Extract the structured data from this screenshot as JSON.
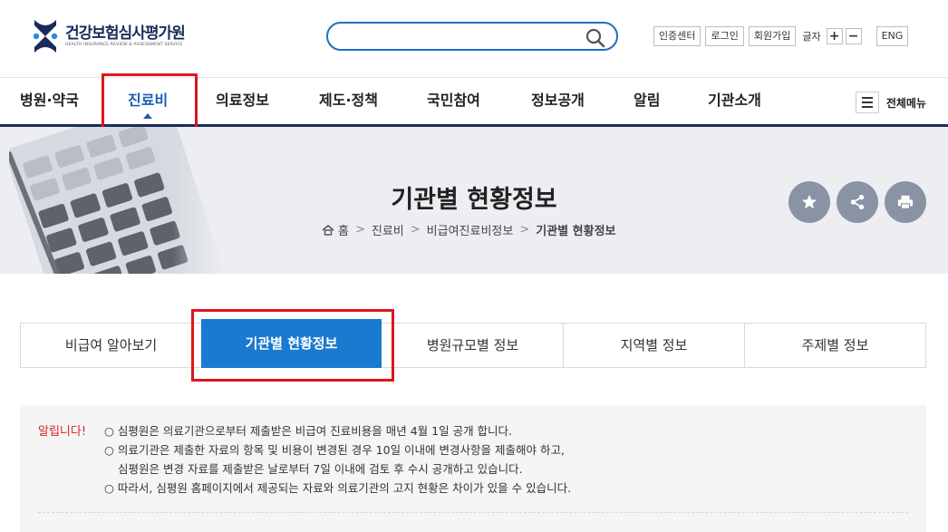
{
  "header": {
    "logo_name": "건강보험심사평가원",
    "logo_sub": "HEALTH INSURANCE REVIEW & ASSESSMENT SERVICE",
    "search": {
      "value": "",
      "placeholder": ""
    },
    "util": {
      "cert": "인증센터",
      "login": "로그인",
      "join": "회원가입",
      "font_label": "글자",
      "font_plus": "+",
      "font_minus": "−",
      "lang": "ENG"
    }
  },
  "gnb": {
    "items": [
      "병원·약국",
      "진료비",
      "의료정보",
      "제도·정책",
      "국민참여",
      "정보공개",
      "알림",
      "기관소개"
    ],
    "active_index": 1,
    "all_menu": "전체메뉴"
  },
  "banner": {
    "title": "기관별 현황정보",
    "breadcrumb": [
      "홈",
      "진료비",
      "비급여진료비정보",
      "기관별 현황정보"
    ],
    "actions": [
      "star-icon",
      "share-icon",
      "print-icon"
    ]
  },
  "tabs": {
    "items": [
      "비급여 알아보기",
      "기관별 현황정보",
      "병원규모별 정보",
      "지역별 정보",
      "주제별 정보"
    ],
    "active_index": 1
  },
  "notice": {
    "label": "알립니다!",
    "lines": [
      "○ 심평원은 의료기관으로부터 제출받은 비급여 진료비용을 매년 4월 1일 공개 합니다.",
      "○ 의료기관은 제출한 자료의 항목 및 비용이 변경된 경우 10일 이내에 변경사항을 제출해야 하고,",
      "심평원은 변경 자료를 제출받은 날로부터 7일 이내에 검토 후 수시 공개하고 있습니다.",
      "○ 따라서, 심평원 홈페이지에서 제공되는 자료와 의료기관의 고지 현황은 차이가 있을 수 있습니다."
    ]
  },
  "colors": {
    "brand_navy": "#1a2a5a",
    "accent_blue": "#1a7ad0",
    "highlight_red": "#e0141e",
    "notice_red": "#d8222a"
  }
}
